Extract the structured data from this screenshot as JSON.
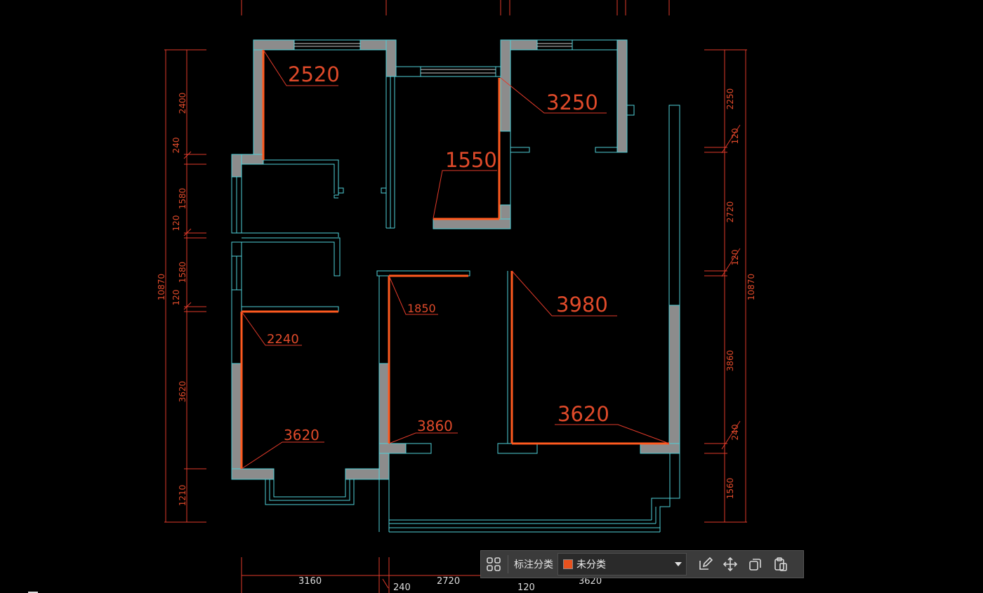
{
  "colors": {
    "background": "#000000",
    "wall_outline": "#4fd1d9",
    "wall_fill": "#8c8c8c",
    "dimension": "#e03a2a",
    "highlight": "#ff5a1f",
    "toolbar_bg": "#3b3b3b"
  },
  "room_dimensions": {
    "r1": "2520",
    "r2": "3250",
    "r3": "1550",
    "r4": "1850",
    "r5": "3980",
    "r6": "2240",
    "r7": "3620",
    "r8": "3860",
    "r9": "3620"
  },
  "left_dimensions": {
    "total": "10870",
    "segments": [
      "2400",
      "240",
      "1580",
      "120",
      "1580",
      "120",
      "3620",
      "1210"
    ]
  },
  "right_dimensions": {
    "total": "10870",
    "segments": [
      "2250",
      "120",
      "2720",
      "120",
      "3860",
      "240",
      "1560"
    ]
  },
  "bottom_dimensions": {
    "segments": [
      "3160",
      "240",
      "2720",
      "120",
      "3620"
    ]
  },
  "toolbar": {
    "grid_icon": "grid-icon",
    "label": "标注分类",
    "selected_value": "未分类",
    "swatch_color": "#e8521e",
    "actions": [
      "edit-icon",
      "move-icon",
      "copy-icon",
      "paste-icon"
    ]
  }
}
